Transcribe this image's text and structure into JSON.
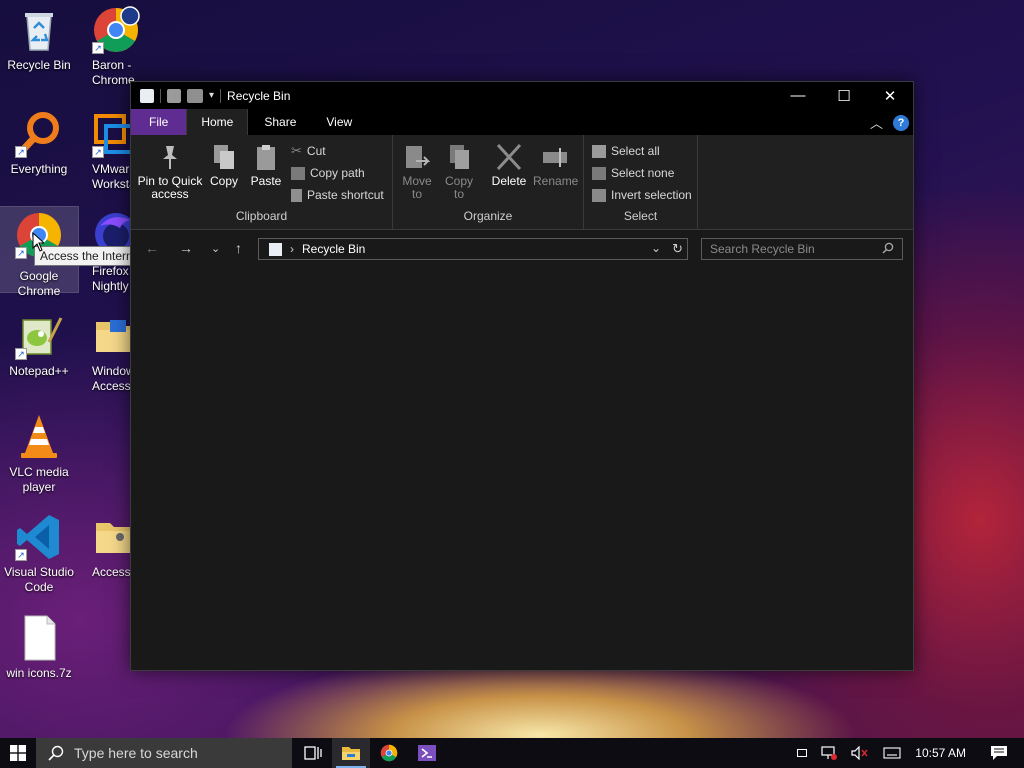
{
  "desktop": {
    "icons": [
      {
        "label": "Recycle Bin"
      },
      {
        "label": "Baron - Chrome"
      },
      {
        "label": "Everything"
      },
      {
        "label": "VMware Workstation"
      },
      {
        "label": "Google Chrome"
      },
      {
        "label": "Firefox Nightly"
      },
      {
        "label": "Notepad++"
      },
      {
        "label": "Windows Accessories"
      },
      {
        "label": "VLC media player"
      },
      {
        "label": "Visual Studio Code"
      },
      {
        "label": "Accessibility"
      },
      {
        "label": "win icons.7z"
      }
    ],
    "tooltip": "Access the Internet"
  },
  "window": {
    "title": "Recycle Bin",
    "controls": {
      "minimize": "—",
      "maximize": "☐",
      "close": "✕"
    },
    "tabs": [
      "File",
      "Home",
      "Share",
      "View"
    ],
    "active_tab": "Home",
    "ribbon": {
      "clipboard": {
        "label": "Clipboard",
        "pin": "Pin to Quick access",
        "copy": "Copy",
        "paste": "Paste",
        "cut": "Cut",
        "copy_path": "Copy path",
        "paste_shortcut": "Paste shortcut"
      },
      "organize": {
        "label": "Organize",
        "move_to": "Move to",
        "copy_to": "Copy to",
        "delete": "Delete",
        "rename": "Rename"
      },
      "select": {
        "label": "Select",
        "select_all": "Select all",
        "select_none": "Select none",
        "invert": "Invert selection"
      }
    },
    "address": {
      "path": "Recycle Bin",
      "separator": "›"
    },
    "search": {
      "placeholder": "Search Recycle Bin"
    }
  },
  "taskbar": {
    "search_placeholder": "Type here to search",
    "clock": "10:57 AM"
  },
  "colors": {
    "file_tab": "#5f2d91",
    "ribbon_bg": "#202020",
    "window_bg": "#191919",
    "accent": "#2d7bd6"
  }
}
